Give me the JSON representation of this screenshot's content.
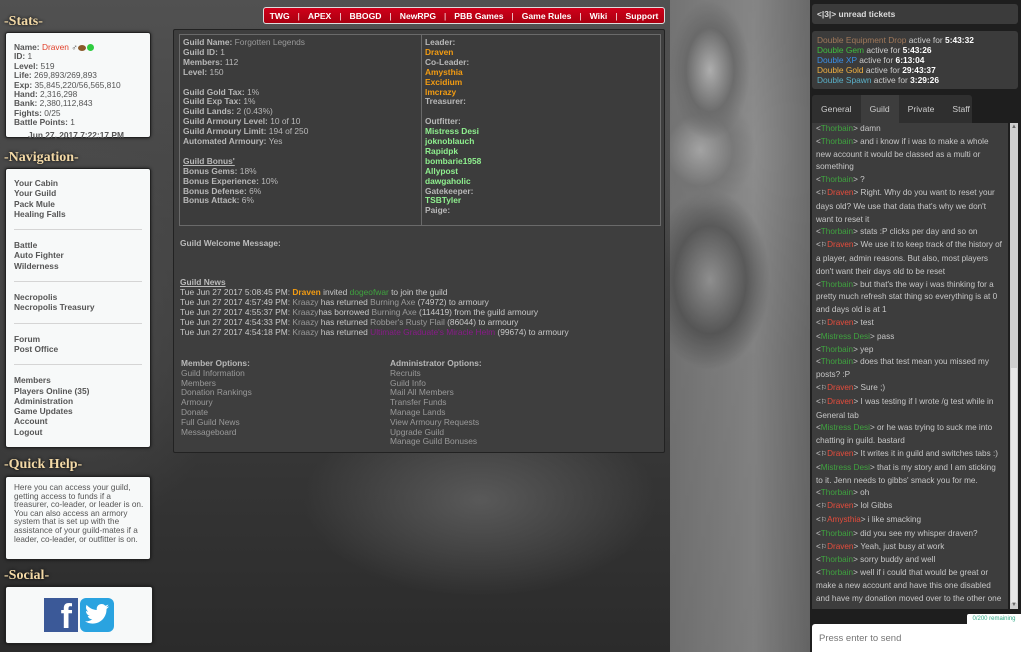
{
  "topmenu": [
    "TWG",
    "APEX",
    "BBOGD",
    "NewRPG",
    "PBB Games",
    "Game Rules",
    "Wiki",
    "Support"
  ],
  "sections": {
    "stats": "-Stats-",
    "navigation": "-Navigation-",
    "quick_help": "-Quick Help-",
    "social": "-Social-"
  },
  "stats": {
    "name_label": "Name:",
    "name": "Draven",
    "icons": [
      "male-gender-icon",
      "football-icon",
      "online-status-icon"
    ],
    "lines": [
      {
        "label": "ID:",
        "value": "1"
      },
      {
        "label": "Level:",
        "value": "519"
      },
      {
        "label": "Life:",
        "value": "269,893/269,893"
      },
      {
        "label": "Exp:",
        "value": "35,845,220/56,565,810"
      },
      {
        "label": "Hand:",
        "value": "2,316,298"
      },
      {
        "label": "Bank:",
        "value": "2,380,112,843"
      },
      {
        "label": "Fights:",
        "value": "0/25"
      },
      {
        "label": "Battle Points:",
        "value": "1"
      }
    ],
    "datetime": "Jun 27, 2017 7:22:17 PM"
  },
  "navigation": [
    [
      "Your Cabin",
      "Your Guild",
      "Pack Mule",
      "Healing Falls"
    ],
    [
      "Battle",
      "Auto Fighter",
      "Wilderness"
    ],
    [
      "Necropolis",
      "Necropolis Treasury"
    ],
    [
      "Forum",
      "Post Office"
    ],
    [
      "Members",
      "Players Online (35)",
      "Administration",
      "Game Updates",
      "Account",
      "Logout"
    ]
  ],
  "quick_help": "Here you can access your guild, getting access to funds if a treasurer, co-leader, or leader is on. You can also access an armory system that is set up with the assistance of your guild-mates if a leader, co-leader, or outfitter is on.",
  "social": {
    "facebook": "f"
  },
  "guild": {
    "name_label": "Guild Name:",
    "name": "Forgotten Legends",
    "basic": [
      {
        "label": "Guild ID:",
        "value": "1"
      },
      {
        "label": "Members:",
        "value": "112"
      },
      {
        "label": "Level:",
        "value": "150"
      }
    ],
    "settings": [
      {
        "label": "Guild Gold Tax:",
        "value": "1%"
      },
      {
        "label": "Guild Exp Tax:",
        "value": "1%"
      },
      {
        "label": "Guild Lands:",
        "value": "2 (0.43%)"
      },
      {
        "label": "Guild Armoury Level:",
        "value": "10 of 10"
      },
      {
        "label": "Guild Armoury Limit:",
        "value": "194 of 250"
      },
      {
        "label": "Automated Armoury:",
        "value": "Yes"
      }
    ],
    "bonus_title": "Guild Bonus'",
    "bonuses": [
      {
        "label": "Bonus Gems:",
        "value": "18%"
      },
      {
        "label": "Bonus Experience:",
        "value": "10%"
      },
      {
        "label": "Bonus Defense:",
        "value": "6%"
      },
      {
        "label": "Bonus Attack:",
        "value": "6%"
      }
    ],
    "roles": {
      "leader_label": "Leader:",
      "leader": [
        "Draven"
      ],
      "coleader_label": "Co-Leader:",
      "coleaders": [
        "Amysthia",
        "Excidium",
        "Imcrazy"
      ],
      "treasurer_label": "Treasurer:",
      "outfitter_label": "Outfitter:",
      "outfitters": [
        "Mistress Desi",
        "joknoblauch",
        "Rapidpk",
        "bombarie1958",
        "Allypost",
        "dawgaholic"
      ],
      "gatekeeper_label": "Gatekeeper:",
      "gatekeepers": [
        "TSBTyler"
      ],
      "paige_label": "Paige:"
    },
    "welcome_label": "Guild Welcome Message:",
    "news_title": "Guild News",
    "news": [
      {
        "time": "Tue Jun 27 2017 5:08:45 PM:",
        "actor": "Draven",
        "action": "invited",
        "target": "dogeofwar",
        "tail": "to join the guild"
      },
      {
        "time": "Tue Jun 27 2017 4:57:49 PM:",
        "actor": "Kraazy",
        "action": "has returned",
        "item": "Burning Axe",
        "tail": "(74972) to armoury"
      },
      {
        "time": "Tue Jun 27 2017 4:55:37 PM:",
        "actor": "Kraazy",
        "action": "has borrowed",
        "item": "Burning Axe",
        "tail": "(114419) from the guild armoury"
      },
      {
        "time": "Tue Jun 27 2017 4:54:33 PM:",
        "actor": "Kraazy",
        "action": "has returned",
        "item": "Robber's Rusty Flail",
        "tail": "(86044) to armoury"
      },
      {
        "time": "Tue Jun 27 2017 4:54:18 PM:",
        "actor": "Kraazy",
        "action": "has returned",
        "item": "Ultimate Graduate's Miracle Helm",
        "tail": "(99674) to armoury"
      }
    ],
    "member_options_title": "Member Options:",
    "member_options": [
      "Guild Information",
      "Members",
      "Donation Rankings",
      "Armoury",
      "Donate",
      "Full Guild News",
      "Messageboard"
    ],
    "admin_options_title": "Administrator Options:",
    "admin_options": [
      "Recruits",
      "Guild Info",
      "Mail All Members",
      "Transfer Funds",
      "Manage Lands",
      "View Armoury Requests",
      "Upgrade Guild",
      "Manage Guild Bonuses"
    ]
  },
  "chat": {
    "tickets": "<|3|> unread tickets",
    "events": [
      {
        "name": "Double Equipment Drop",
        "color": "#a0785a",
        "text": "active for",
        "time": "5:43:32"
      },
      {
        "name": "Double Gem",
        "color": "#3fbf3f",
        "text": "active for",
        "time": "5:43:26"
      },
      {
        "name": "Double XP",
        "color": "#3a8fe8",
        "text": "active for",
        "time": "6:13:04"
      },
      {
        "name": "Double Gold",
        "color": "#f0b040",
        "text": "active for",
        "time": "29:43:37"
      },
      {
        "name": "Double Spawn",
        "color": "#5ab0c8",
        "text": "active for",
        "time": "3:29:26"
      }
    ],
    "tabs": [
      "General",
      "Guild",
      "Private",
      "Staff"
    ],
    "active_tab": "Guild",
    "messages": [
      {
        "user": "Thorbain",
        "staff": false,
        "text": "damn"
      },
      {
        "user": "Thorbain",
        "staff": false,
        "text": "and i know if i was to make a whole new account it would be classed as a multi or something"
      },
      {
        "user": "Thorbain",
        "staff": false,
        "text": "?"
      },
      {
        "user": "Draven",
        "staff": true,
        "text": "Right. Why do you want to reset your days old? We use that data that's why we don't want to reset it"
      },
      {
        "user": "Thorbain",
        "staff": false,
        "text": "stats :P clicks per day and so on"
      },
      {
        "user": "Draven",
        "staff": true,
        "text": "We use it to keep track of the history of a player, admin reasons. But also, most players don't want their days old to be reset"
      },
      {
        "user": "Thorbain",
        "staff": false,
        "text": "but that's the way i was thinking for a pretty much refresh stat thing so everything is at 0 and days old is at 1"
      },
      {
        "user": "Draven",
        "staff": true,
        "text": "test"
      },
      {
        "user": "Mistress Desi",
        "staff": false,
        "text": "pass"
      },
      {
        "user": "Thorbain",
        "staff": false,
        "text": "yep"
      },
      {
        "user": "Thorbain",
        "staff": false,
        "text": "does that test mean you missed my posts? :P"
      },
      {
        "user": "Draven",
        "staff": true,
        "text": "Sure ;)"
      },
      {
        "user": "Draven",
        "staff": true,
        "text": "I was testing if I wrote /g test while in General tab"
      },
      {
        "user": "Mistress Desi",
        "staff": false,
        "text": "or he was trying to suck me into chatting in guild. bastard"
      },
      {
        "user": "Draven",
        "staff": true,
        "text": "It writes it in guild and switches tabs :)"
      },
      {
        "user": "Mistress Desi",
        "staff": false,
        "text": "that is my story and I am sticking to it. Jenn needs to gibbs' smack you for me."
      },
      {
        "user": "Thorbain",
        "staff": false,
        "text": "oh"
      },
      {
        "user": "Draven",
        "staff": true,
        "text": "lol Gibbs"
      },
      {
        "user": "Amysthia",
        "staff": true,
        "text": "i like smacking"
      },
      {
        "user": "Thorbain",
        "staff": false,
        "text": "did you see my whisper draven?"
      },
      {
        "user": "Draven",
        "staff": true,
        "text": "Yeah, just busy at work"
      },
      {
        "user": "Thorbain",
        "staff": false,
        "text": "sorry buddy and well"
      },
      {
        "user": "Thorbain",
        "staff": false,
        "text": "well if i could that would be great or make a new account and have this one disabled and have my donation moved over to the other one"
      }
    ],
    "remaining": "0/200 remaining",
    "input_placeholder": "Press enter to send"
  }
}
